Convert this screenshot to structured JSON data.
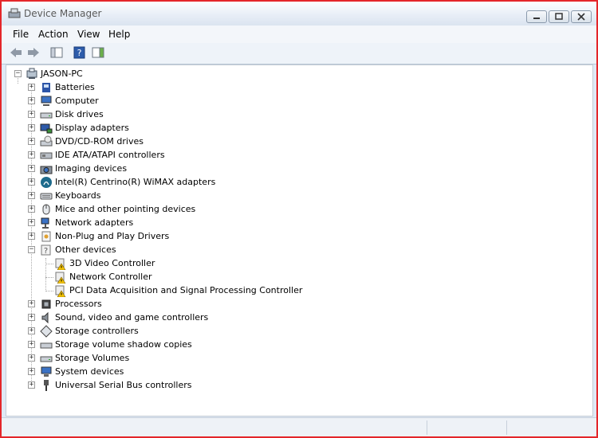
{
  "window": {
    "title": "Device Manager"
  },
  "menu": {
    "file": "File",
    "action": "Action",
    "view": "View",
    "help": "Help"
  },
  "tree": {
    "root": "JASON-PC",
    "items": [
      {
        "label": "Batteries",
        "icon": "battery-icon"
      },
      {
        "label": "Computer",
        "icon": "computer-icon"
      },
      {
        "label": "Disk drives",
        "icon": "disk-drive-icon"
      },
      {
        "label": "Display adapters",
        "icon": "display-adapter-icon"
      },
      {
        "label": "DVD/CD-ROM drives",
        "icon": "dvd-drive-icon"
      },
      {
        "label": "IDE ATA/ATAPI controllers",
        "icon": "ide-controller-icon"
      },
      {
        "label": "Imaging devices",
        "icon": "camera-icon"
      },
      {
        "label": "Intel(R) Centrino(R) WiMAX adapters",
        "icon": "wimax-icon"
      },
      {
        "label": "Keyboards",
        "icon": "keyboard-icon"
      },
      {
        "label": "Mice and other pointing devices",
        "icon": "mouse-icon"
      },
      {
        "label": "Network adapters",
        "icon": "network-adapter-icon"
      },
      {
        "label": "Non-Plug and Play Drivers",
        "icon": "driver-icon"
      },
      {
        "label": "Other devices",
        "icon": "unknown-device-icon",
        "expanded": true
      },
      {
        "label": "Processors",
        "icon": "processor-icon"
      },
      {
        "label": "Sound, video and game controllers",
        "icon": "speaker-icon"
      },
      {
        "label": "Storage controllers",
        "icon": "storage-controller-icon"
      },
      {
        "label": "Storage volume shadow copies",
        "icon": "shadow-copy-icon"
      },
      {
        "label": "Storage Volumes",
        "icon": "storage-volume-icon"
      },
      {
        "label": "System devices",
        "icon": "system-device-icon"
      },
      {
        "label": "Universal Serial Bus controllers",
        "icon": "usb-icon"
      }
    ],
    "other_devices": [
      {
        "label": "3D Video Controller",
        "icon": "warning-device-icon"
      },
      {
        "label": "Network Controller",
        "icon": "warning-device-icon"
      },
      {
        "label": "PCI Data Acquisition and Signal Processing Controller",
        "icon": "warning-device-icon"
      }
    ]
  },
  "colors": {
    "window_border": "#e4262a",
    "chrome": "#dfe9f5",
    "warning": "#f5c400"
  }
}
